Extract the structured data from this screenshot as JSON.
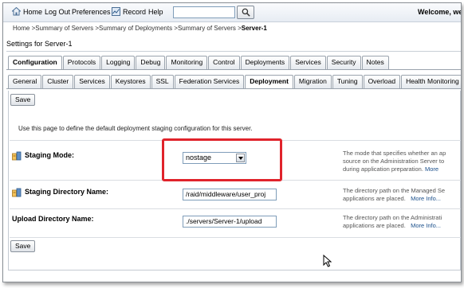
{
  "topbar": {
    "home": "Home",
    "logout": "Log Out",
    "preferences": "Preferences",
    "record": "Record",
    "help": "Help",
    "search_value": "",
    "welcome": "Welcome, we"
  },
  "breadcrumb": {
    "trail": "Home >Summary of Servers >Summary of Deployments >Summary of Servers >",
    "current": "Server-1"
  },
  "page_title": "Settings for Server-1",
  "tabs_primary": [
    "Configuration",
    "Protocols",
    "Logging",
    "Debug",
    "Monitoring",
    "Control",
    "Deployments",
    "Services",
    "Security",
    "Notes"
  ],
  "tabs_primary_active": "Configuration",
  "tabs_secondary": [
    "General",
    "Cluster",
    "Services",
    "Keystores",
    "SSL",
    "Federation Services",
    "Deployment",
    "Migration",
    "Tuning",
    "Overload",
    "Health Monitoring"
  ],
  "tabs_secondary_active": "Deployment",
  "save_label": "Save",
  "intro": "Use this page to define the default deployment staging configuration for this server.",
  "fields": {
    "staging_mode": {
      "label": "Staging Mode:",
      "value": "nostage",
      "help1": "The mode that specifies whether an ap",
      "help2": "source on the Administration Server to",
      "help3": "during application preparation.",
      "more": "More"
    },
    "staging_dir": {
      "label": "Staging Directory Name:",
      "value": "/raid/middleware/user_proj",
      "help1": "The directory path on the Managed Se",
      "help2": "applications are placed.",
      "more": "More Info..."
    },
    "upload_dir": {
      "label": "Upload Directory Name:",
      "value": "./servers/Server-1/upload",
      "help1": "The directory path on the Administrati",
      "help2": "applications are placed.",
      "more": "More Info..."
    }
  },
  "colors": {
    "highlight": "#e0232b",
    "link": "#1a4f8b",
    "topbar": "#e7ecf3"
  }
}
